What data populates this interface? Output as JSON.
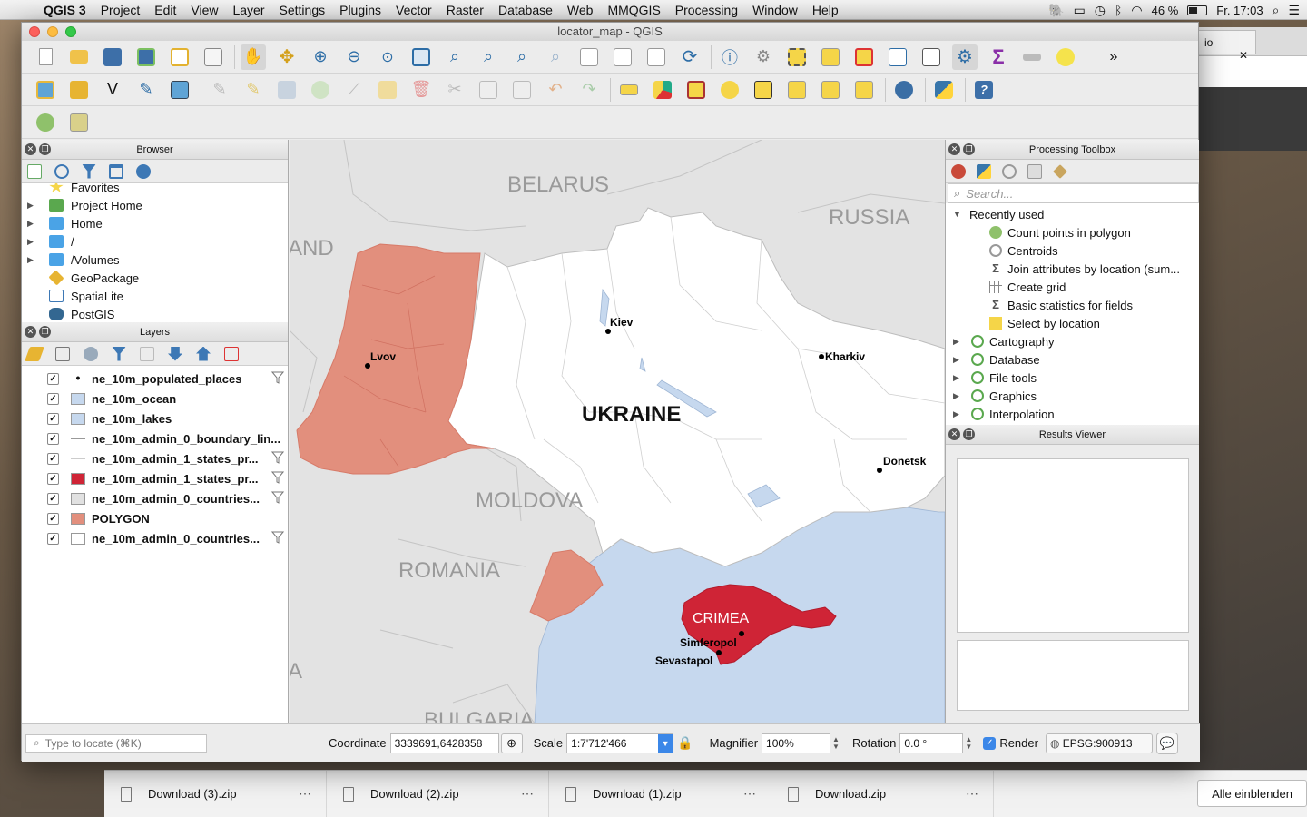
{
  "menubar": {
    "app": "QGIS 3",
    "items": [
      "Project",
      "Edit",
      "View",
      "Layer",
      "Settings",
      "Plugins",
      "Vector",
      "Raster",
      "Database",
      "Web",
      "MMQGIS",
      "Processing",
      "Window",
      "Help"
    ],
    "battery": "46 %",
    "clock": "Fr. 17:03"
  },
  "window": {
    "title": "locator_map - QGIS"
  },
  "browser_panel": {
    "title": "Browser",
    "items": [
      {
        "label": "Favorites",
        "icon": "star-icon",
        "expand": false
      },
      {
        "label": "Project Home",
        "icon": "project-home-icon",
        "expand": true
      },
      {
        "label": "Home",
        "icon": "folder-icon",
        "expand": true
      },
      {
        "label": "/",
        "icon": "folder-icon",
        "expand": true
      },
      {
        "label": "/Volumes",
        "icon": "folder-icon",
        "expand": true
      },
      {
        "label": "GeoPackage",
        "icon": "geopackage-icon",
        "expand": false
      },
      {
        "label": "SpatiaLite",
        "icon": "spatialite-icon",
        "expand": false
      },
      {
        "label": "PostGIS",
        "icon": "postgis-icon",
        "expand": false
      }
    ]
  },
  "layers_panel": {
    "title": "Layers",
    "layers": [
      {
        "name": "ne_10m_populated_places",
        "symbol": "point",
        "color": "#000000",
        "filter": true
      },
      {
        "name": "ne_10m_ocean",
        "symbol": "fill",
        "color": "#c6d8ee",
        "filter": false
      },
      {
        "name": "ne_10m_lakes",
        "symbol": "fill",
        "color": "#c6d8ee",
        "filter": false
      },
      {
        "name": "ne_10m_admin_0_boundary_lin...",
        "symbol": "line",
        "color": "#999999",
        "filter": false
      },
      {
        "name": "ne_10m_admin_1_states_pr...",
        "symbol": "line",
        "color": "#cccccc",
        "filter": true
      },
      {
        "name": "ne_10m_admin_1_states_pr...",
        "symbol": "fill",
        "color": "#cf2436",
        "filter": true
      },
      {
        "name": "ne_10m_admin_0_countries...",
        "symbol": "fill",
        "color": "#e1e1e1",
        "filter": true
      },
      {
        "name": "POLYGON",
        "symbol": "fill",
        "color": "#e28f7d",
        "filter": false
      },
      {
        "name": "ne_10m_admin_0_countries...",
        "symbol": "fill",
        "color": "#ffffff",
        "filter": true
      }
    ]
  },
  "map": {
    "countries": [
      "BELARUS",
      "RUSSIA",
      "AND",
      "MOLDOVA",
      "ROMANIA",
      "BULGARIA",
      "A"
    ],
    "main_label": "UKRAINE",
    "region_label": "CRIMEA",
    "cities": [
      "Kiev",
      "Lvov",
      "Kharkiv",
      "Donetsk",
      "Simferopol",
      "Sevastapol"
    ],
    "colors": {
      "background": "#e3e3e3",
      "ukraine": "#ffffff",
      "west": "#e28f7d",
      "crimea": "#cf2436",
      "sea": "#c6d8ee"
    }
  },
  "processing_toolbox": {
    "title": "Processing Toolbox",
    "search_placeholder": "Search...",
    "recently_used_label": "Recently used",
    "recent": [
      {
        "label": "Count points in polygon",
        "icon": "count-points-icon"
      },
      {
        "label": "Centroids",
        "icon": "centroids-icon"
      },
      {
        "label": "Join attributes by location (sum...",
        "icon": "sigma-icon"
      },
      {
        "label": "Create grid",
        "icon": "grid-icon"
      },
      {
        "label": "Basic statistics for fields",
        "icon": "sigma-icon"
      },
      {
        "label": "Select by location",
        "icon": "select-icon"
      }
    ],
    "groups": [
      "Cartography",
      "Database",
      "File tools",
      "Graphics",
      "Interpolation"
    ]
  },
  "results_viewer": {
    "title": "Results Viewer"
  },
  "statusbar": {
    "locate_placeholder": "Type to locate (⌘K)",
    "coordinate_label": "Coordinate",
    "coordinate_value": "3339691,6428358",
    "scale_label": "Scale",
    "scale_value": "1:7'712'466",
    "magnifier_label": "Magnifier",
    "magnifier_value": "100%",
    "rotation_label": "Rotation",
    "rotation_value": "0.0 °",
    "render_label": "Render",
    "crs": "EPSG:900913"
  },
  "downloads": {
    "files": [
      "Download (3).zip",
      "Download (2).zip",
      "Download (1).zip",
      "Download.zip"
    ],
    "show_all": "Alle einblenden"
  },
  "background_tab": {
    "label": "io"
  }
}
